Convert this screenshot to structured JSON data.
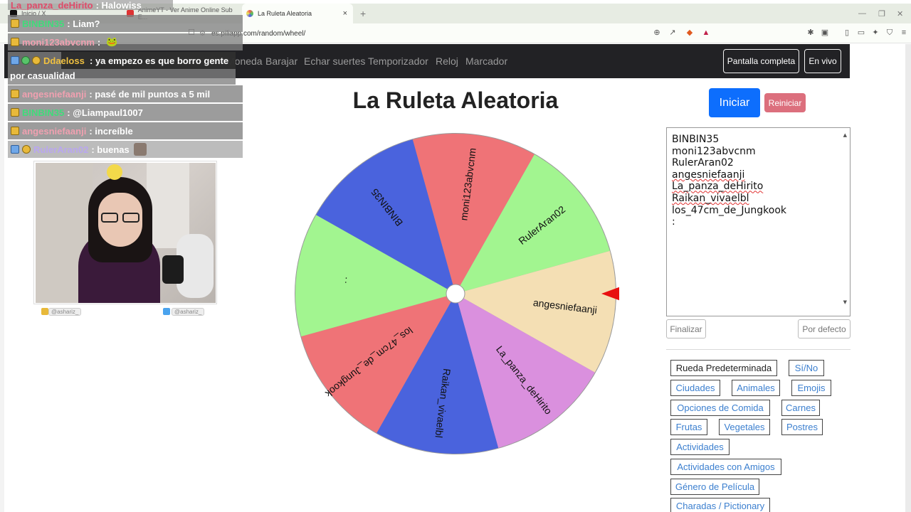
{
  "browser": {
    "tabs": [
      {
        "label": "Inicio / X"
      },
      {
        "label": "AnimeYT - Ver Anime Online Sub E..."
      },
      {
        "label": "La Ruleta Aleatoria"
      }
    ],
    "new_tab": "+",
    "close": "×",
    "url": "es.piliapp.com/random/wheel/"
  },
  "site_nav": {
    "links": [
      "Moneda",
      "Barajar",
      "Echar suertes",
      "Temporizador",
      "Reloj",
      "Marcador"
    ],
    "fullscreen_label": "Pantalla completa",
    "live_label": "En vivo"
  },
  "page": {
    "title": "La Ruleta Aleatoria",
    "start_label": "Iniciar",
    "reset_label": "Reiniciar",
    "names": [
      "BINBIN35",
      "moni123abvcnm",
      "RulerAran02",
      "angesniefaanji",
      "La_panza_deHirito",
      "Raikan_vivaelbl",
      "los_47cm_de_Jungkook",
      ":"
    ],
    "finish_label": "Finalizar",
    "default_label": "Por defecto",
    "presets": [
      "Rueda Predeterminada",
      "Sí/No",
      "Ciudades",
      "Animales",
      "Emojis",
      "Opciones de Comida",
      "Carnes",
      "Frutas",
      "Vegetales",
      "Postres",
      "Actividades",
      "Actividades con Amigos",
      "Género de Película",
      "Charadas / Pictionary"
    ]
  },
  "wheel": {
    "segments": [
      {
        "label": "RulerAran02",
        "color": "#a2f590"
      },
      {
        "label": "angesniefaanji",
        "color": "#f4dfb4"
      },
      {
        "label": "La_panza_deHirito",
        "color": "#da90de"
      },
      {
        "label": "Raikan_vivaelbl",
        "color": "#4a63dd"
      },
      {
        "label": "los_47cm_de_Jungkook",
        "color": "#ef7377"
      },
      {
        "label": ":",
        "color": "#a2f590"
      },
      {
        "label": "BINBIN35",
        "color": "#4a63dd"
      },
      {
        "label": "moni123abvcnm",
        "color": "#ef7377"
      }
    ],
    "pointer_color": "#e81010"
  },
  "stream_chat": [
    {
      "user": "La_panza_deHirito",
      "text": ": Halowiss",
      "user_color": "#e04a6a"
    },
    {
      "user": "BINBIN35",
      "text": ": Liam?",
      "user_color": "#3fdc7a"
    },
    {
      "user": "moni123abvcnm",
      "text": ":",
      "user_color": "#f0a0b0"
    },
    {
      "user": "Ddaeloss",
      "text": ": ya empezo es que borro gente",
      "text2": "por casualidad",
      "user_color": "#f0c040"
    },
    {
      "user": "angesniefaanji",
      "text": ": pasé de mil puntos a 5 mil",
      "user_color": "#f0a0b0"
    },
    {
      "user": "BINBIN35",
      "text": ": @Liampaul1007",
      "user_color": "#3fdc7a"
    },
    {
      "user": "angesniefaanji",
      "text": ": increíble",
      "user_color": "#f0a0b0"
    },
    {
      "user": "RulerAran02",
      "text": ": buenas",
      "user_color": "#b9a6f0"
    }
  ],
  "stream_social": [
    "@ashariz_",
    "@ashariz_"
  ]
}
